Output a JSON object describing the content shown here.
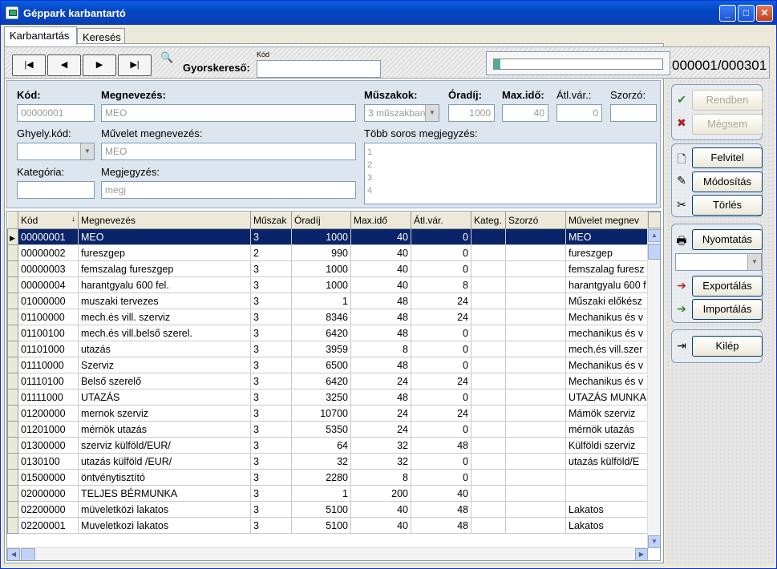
{
  "window": {
    "title": "Géppark karbantartó",
    "minimize": "_",
    "maximize": "□",
    "close": "✕"
  },
  "tabs": [
    {
      "label": "Karbantartás"
    },
    {
      "label": "Keresés"
    }
  ],
  "nav": {
    "first": "|◀",
    "prev": "◀",
    "next": "▶",
    "last": "▶|",
    "gyorskereso_label": "Gyorskereső:",
    "kod_small": "Kód",
    "gyorskereso_value": "",
    "counter": "000001/000301",
    "progress_fraction": 0.003
  },
  "form": {
    "kod_label": "Kód:",
    "kod_value": "00000001",
    "megnevezes_label": "Megnevezés:",
    "megnevezes_value": "MEO",
    "muszakok_label": "Műszakok:",
    "muszakok_value": "3 műszakban",
    "oradij_label": "Óradíj:",
    "oradij_value": "1000",
    "maxido_label": "Max.idő:",
    "maxido_value": "40",
    "atlvar_label": "Átl.vár.:",
    "atlvar_value": "0",
    "szorzo_label": "Szorzó:",
    "szorzo_value": "",
    "ghyely_label": "Ghyely.kód:",
    "ghyely_value": "",
    "muvelet_label": "Művelet megnevezés:",
    "muvelet_value": "MEO",
    "tobb_label": "Több soros megjegyzés:",
    "tobb_lines": [
      "1",
      "2",
      "3",
      "4"
    ],
    "kategoria_label": "Kategória:",
    "kategoria_value": "",
    "megjegyzes_label": "Megjegyzés:",
    "megjegyzes_value": "megj"
  },
  "grid": {
    "columns": [
      "Kód",
      "Megnevezés",
      "Műszak",
      "Óradíj",
      "Max.idő",
      "Átl.vár.",
      "Kateg.",
      "Szorzó",
      "Művelet megnev"
    ],
    "rows": [
      [
        "00000001",
        "MEO",
        "3",
        "1000",
        "40",
        "0",
        "",
        "",
        "MEO"
      ],
      [
        "00000002",
        "fureszgep",
        "2",
        "990",
        "40",
        "0",
        "",
        "",
        "fureszgep"
      ],
      [
        "00000003",
        "femszalag fureszgep",
        "3",
        "1000",
        "40",
        "0",
        "",
        "",
        "femszalag furesz"
      ],
      [
        "00000004",
        "harantgyalu 600 fel.",
        "3",
        "1000",
        "40",
        "8",
        "",
        "",
        "harantgyalu 600 f"
      ],
      [
        "01000000",
        "muszaki tervezes",
        "3",
        "1",
        "48",
        "24",
        "",
        "",
        "Műszaki előkész"
      ],
      [
        "01100000",
        "mech.és vill. szerviz",
        "3",
        "8346",
        "48",
        "24",
        "",
        "",
        "Mechanikus és v"
      ],
      [
        "01100100",
        "mech.és vill.belső szerel.",
        "3",
        "6420",
        "48",
        "0",
        "",
        "",
        "mechanikus és v"
      ],
      [
        "01101000",
        "utazás",
        "3",
        "3959",
        "8",
        "0",
        "",
        "",
        "mech.és vill.szer"
      ],
      [
        "01110000",
        "Szerviz",
        "3",
        "6500",
        "48",
        "0",
        "",
        "",
        "Mechanikus és v"
      ],
      [
        "01110100",
        "Belső szerelő",
        "3",
        "6420",
        "24",
        "24",
        "",
        "",
        "Mechanikus és v"
      ],
      [
        "01111000",
        "UTAZÁS",
        "3",
        "3250",
        "48",
        "0",
        "",
        "",
        "UTAZÁS MUNKA"
      ],
      [
        "01200000",
        "mernok szerviz",
        "3",
        "10700",
        "24",
        "24",
        "",
        "",
        "Mámök szerviz"
      ],
      [
        "01201000",
        "mérnök utazás",
        "3",
        "5350",
        "24",
        "0",
        "",
        "",
        "mérnök utazás"
      ],
      [
        "01300000",
        "szerviz külföld/EUR/",
        "3",
        "64",
        "32",
        "48",
        "",
        "",
        "Külföldi szerviz"
      ],
      [
        "0130100",
        "utazás külföld /EUR/",
        "3",
        "32",
        "32",
        "0",
        "",
        "",
        "utazás külföld/E"
      ],
      [
        "01500000",
        "öntvénytisztító",
        "3",
        "2280",
        "8",
        "0",
        "",
        "",
        ""
      ],
      [
        "02000000",
        "TELJES BÉRMUNKA",
        "3",
        "1",
        "200",
        "40",
        "",
        "",
        ""
      ],
      [
        "02200000",
        "müveletközi lakatos",
        "3",
        "5100",
        "40",
        "48",
        "",
        "",
        "Lakatos"
      ],
      [
        "02200001",
        "Muveletkozi lakatos",
        "3",
        "5100",
        "40",
        "48",
        "",
        "",
        "Lakatos"
      ]
    ]
  },
  "actions": {
    "rendben": "Rendben",
    "megsem": "Mégsem",
    "felvitel": "Felvitel",
    "modositas": "Módosítás",
    "torles": "Törlés",
    "nyomtatas": "Nyomtatás",
    "exportalas": "Exportálás",
    "importalas": "Importálás",
    "kilep": "Kilép",
    "print_combo_value": ""
  },
  "icons": {
    "ok": "✔",
    "cancel": "✖",
    "new": "🗋",
    "edit": "✎",
    "delete": "✂",
    "print": "🖶",
    "export": "➔",
    "import": "➔",
    "exit": "⇥",
    "search": "🔍",
    "sort": "↓"
  },
  "colors": {
    "selected_row": "#0a246a",
    "title_bar": "#0447c6",
    "ok_green": "#2a8a2a",
    "cancel_red": "#b22222"
  }
}
